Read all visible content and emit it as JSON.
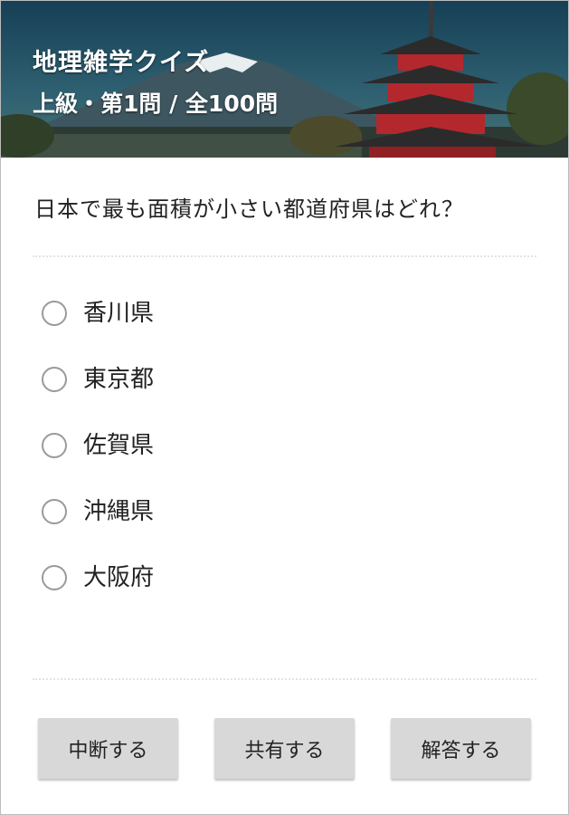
{
  "header": {
    "title": "地理雑学クイズ",
    "subtitle": "上級・第1問 / 全100問",
    "background_image": "mount-fuji-pagoda-photo"
  },
  "question": {
    "text": "日本で最も面積が小さい都道府県はどれ？"
  },
  "options": [
    {
      "label": "香川県",
      "selected": false
    },
    {
      "label": "東京都",
      "selected": false
    },
    {
      "label": "佐賀県",
      "selected": false
    },
    {
      "label": "沖縄県",
      "selected": false
    },
    {
      "label": "大阪府",
      "selected": false
    }
  ],
  "buttons": {
    "suspend_label": "中断する",
    "share_label": "共有する",
    "answer_label": "解答する"
  },
  "colors": {
    "button_bg": "#d8d8d8",
    "radio_border": "#9a9a9a",
    "pagoda_red": "#b3282d"
  }
}
